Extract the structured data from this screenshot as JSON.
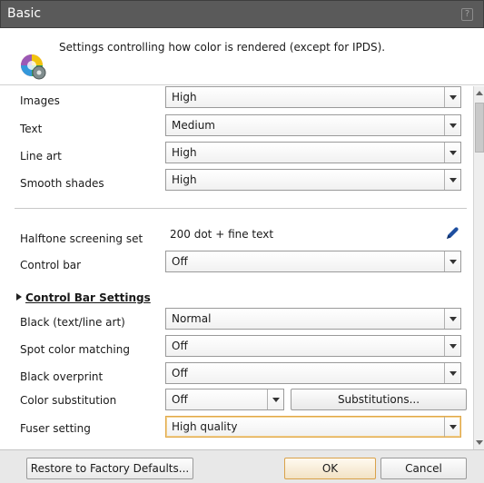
{
  "window": {
    "title": "Basic",
    "help_label": "?"
  },
  "header": {
    "description": "Settings controlling how color is rendered (except for IPDS)."
  },
  "settings": {
    "images": {
      "label": "Images",
      "value": "High"
    },
    "text": {
      "label": "Text",
      "value": "Medium"
    },
    "line_art": {
      "label": "Line art",
      "value": "High"
    },
    "smooth_shades": {
      "label": "Smooth shades",
      "value": "High"
    },
    "halftone": {
      "label": "Halftone screening set",
      "value": "200 dot + fine text"
    },
    "control_bar": {
      "label": "Control bar",
      "value": "Off"
    },
    "control_bar_settings": {
      "label": "Control Bar Settings"
    },
    "black_text": {
      "label": "Black (text/line art)",
      "value": "Normal"
    },
    "spot_color": {
      "label": "Spot color matching",
      "value": "Off"
    },
    "black_overprint": {
      "label": "Black overprint",
      "value": "Off"
    },
    "color_substitution": {
      "label": "Color substitution",
      "value": "Off",
      "button_label": "Substitutions..."
    },
    "fuser": {
      "label": "Fuser setting",
      "value": "High quality"
    }
  },
  "footer": {
    "restore_label": "Restore to Factory Defaults...",
    "ok_label": "OK",
    "cancel_label": "Cancel"
  },
  "colors": {
    "titlebar": "#5a5a5a",
    "focus": "#e0a84a"
  },
  "icons": [
    "color-settings-icon",
    "pen-icon",
    "help-icon"
  ]
}
